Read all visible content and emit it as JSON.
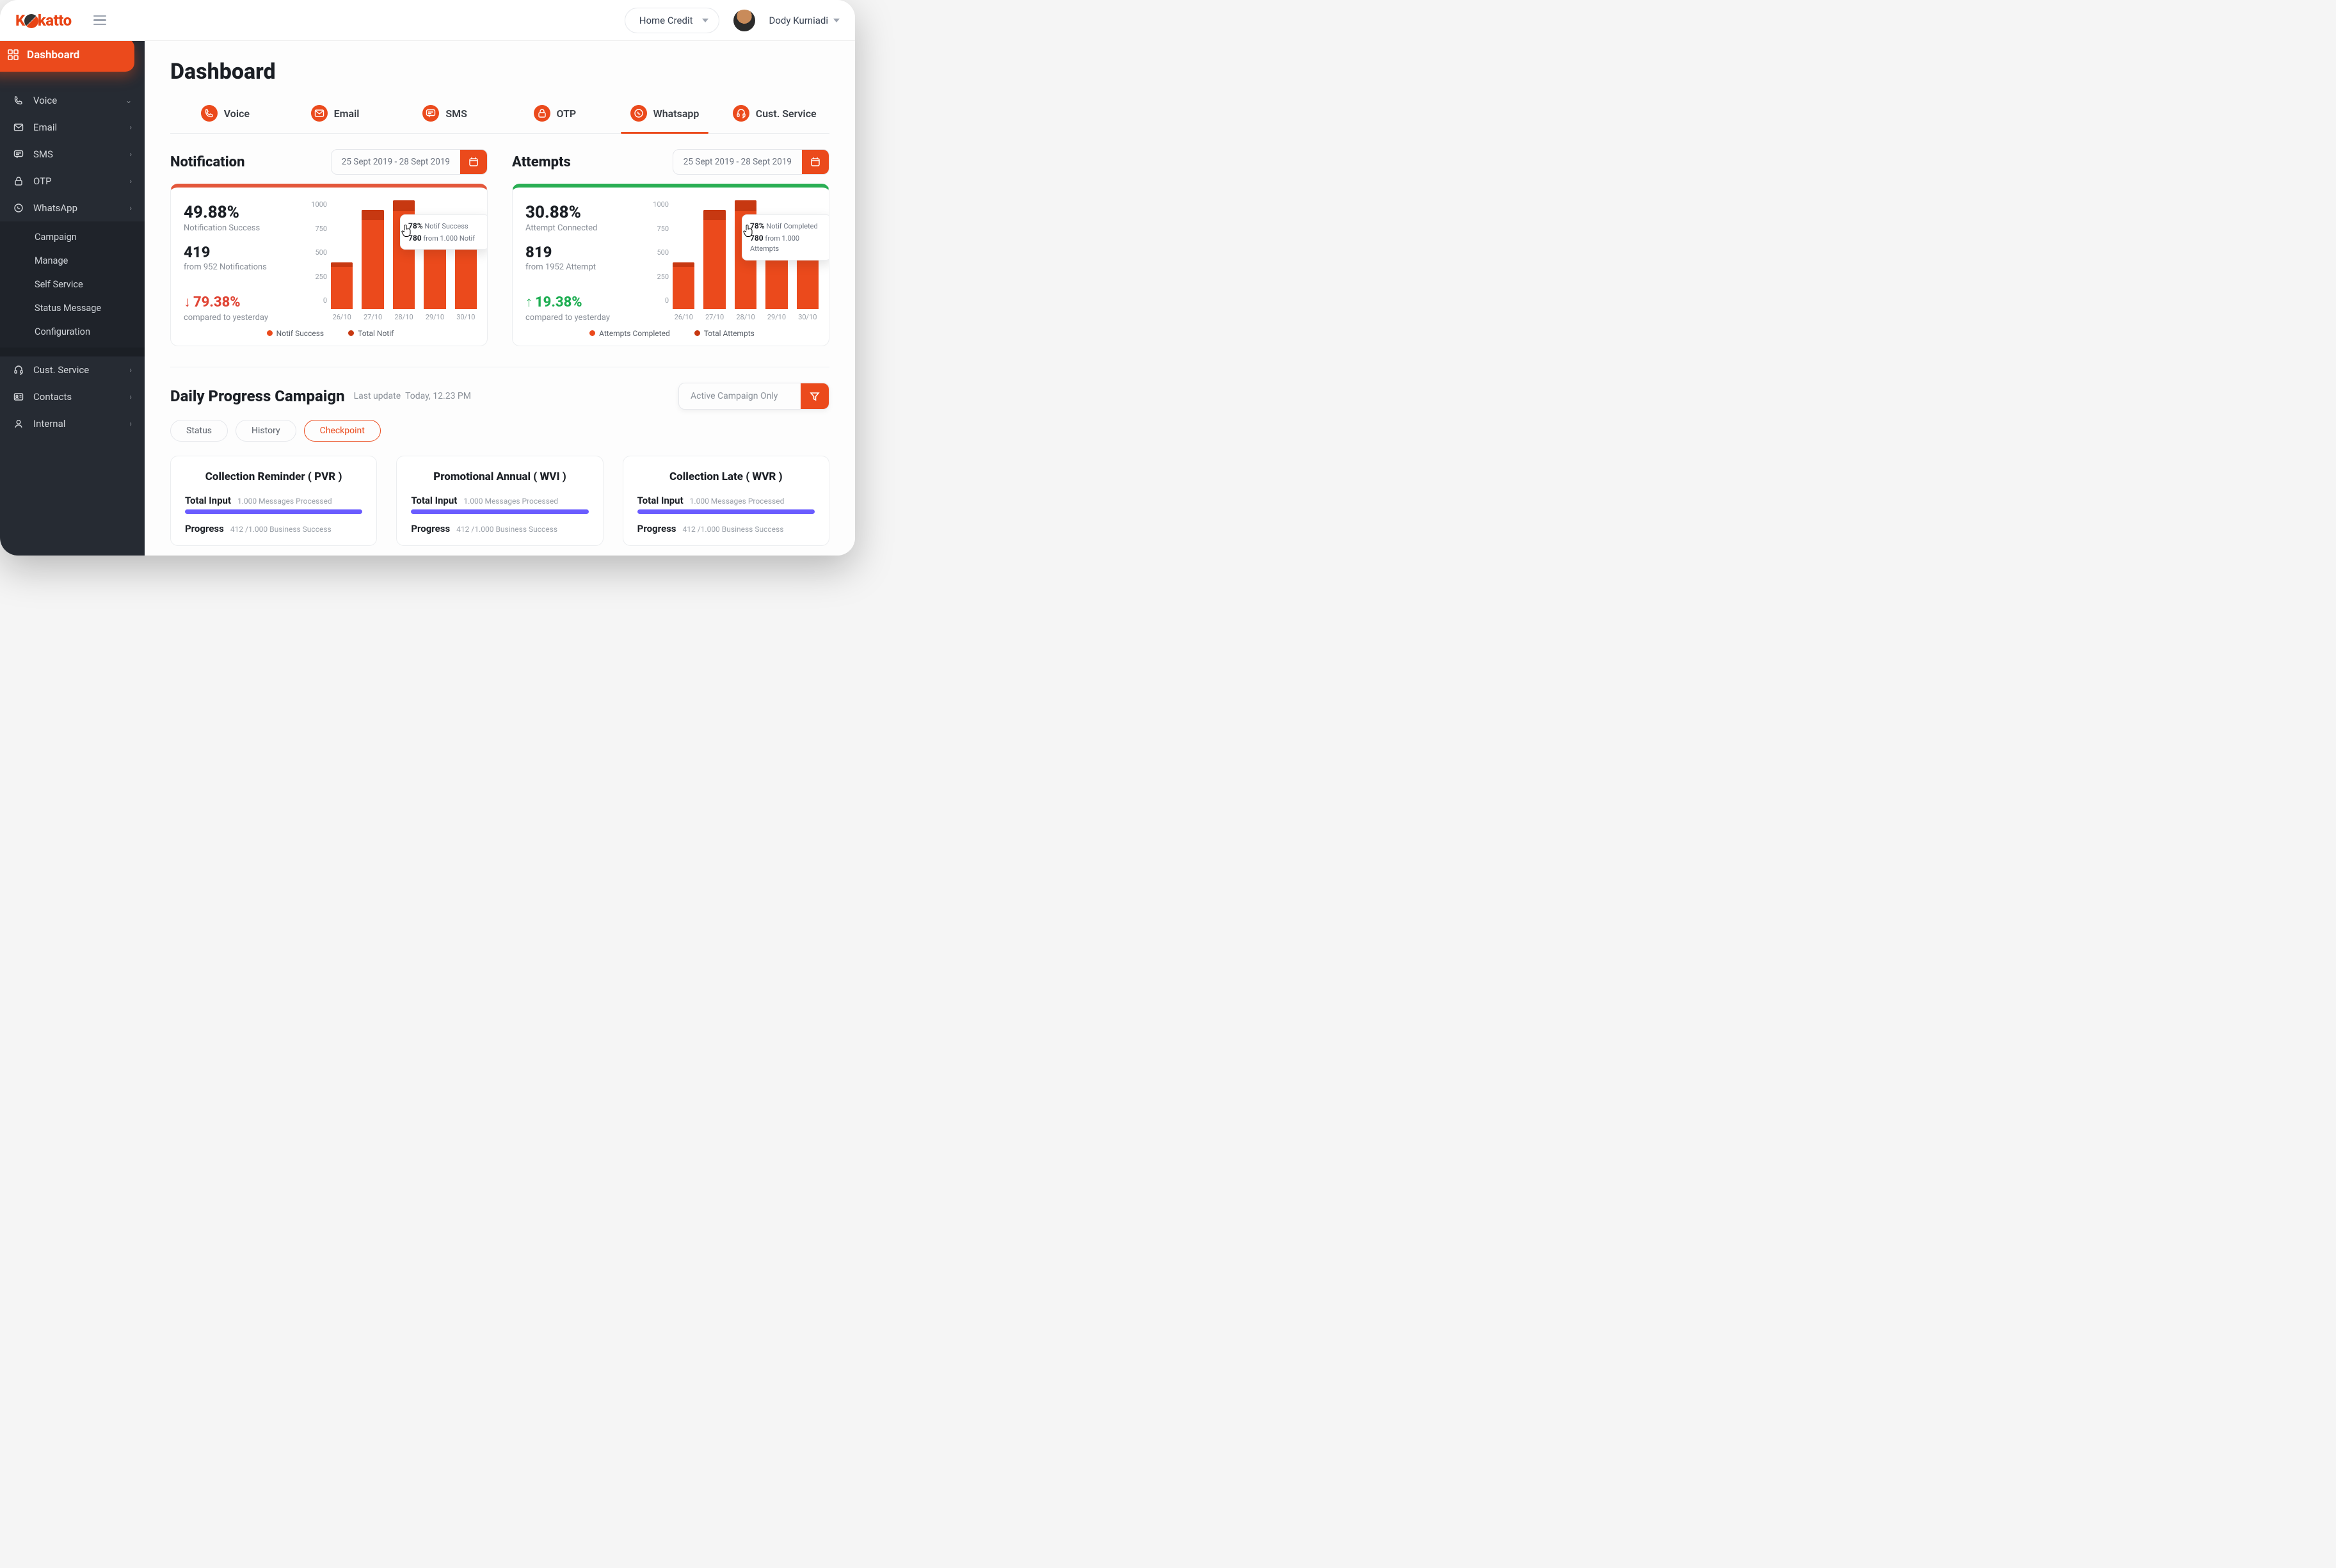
{
  "brand": "Kokatto",
  "header": {
    "credit_selector": "Home Credit",
    "user_name": "Dody Kurniadi"
  },
  "sidebar": {
    "active": "Dashboard",
    "items": [
      {
        "label": "Voice",
        "icon": "phone"
      },
      {
        "label": "Email",
        "icon": "mail"
      },
      {
        "label": "SMS",
        "icon": "chat"
      },
      {
        "label": "OTP",
        "icon": "lock"
      },
      {
        "label": "WhatsApp",
        "icon": "whatsapp"
      }
    ],
    "whatsapp_sub": [
      "Campaign",
      "Manage",
      "Self Service",
      "Status Message",
      "Configuration"
    ],
    "items2": [
      {
        "label": "Cust. Service",
        "icon": "headset"
      },
      {
        "label": "Contacts",
        "icon": "card"
      },
      {
        "label": "Internal",
        "icon": "user"
      }
    ]
  },
  "page_title": "Dashboard",
  "tabs": [
    "Voice",
    "Email",
    "SMS",
    "OTP",
    "Whatsapp",
    "Cust. Service"
  ],
  "active_tab": "Whatsapp",
  "notification": {
    "title": "Notification",
    "date_range": "25 Sept 2019 - 28 Sept 2019",
    "pct": "49.88%",
    "pct_label": "Notification Success",
    "count": "419",
    "count_label": "from 952 Notifications",
    "delta": "79.38%",
    "delta_dir": "down",
    "delta_label": "compared to yesterday",
    "legend": [
      "Notif Success",
      "Total Notif"
    ],
    "tooltip": {
      "pct": "78%",
      "pct_label": "Notif Success",
      "n": "780",
      "n_label": "from 1.000 Notif"
    }
  },
  "attempts": {
    "title": "Attempts",
    "date_range": "25 Sept 2019 - 28 Sept 2019",
    "pct": "30.88%",
    "pct_label": "Attempt Connected",
    "count": "819",
    "count_label": "from 1952 Attempt",
    "delta": "19.38%",
    "delta_dir": "up",
    "delta_label": "compared to yesterday",
    "legend": [
      "Attempts Completed",
      "Total Attempts"
    ],
    "tooltip": {
      "pct": "78%",
      "pct_label": "Notif Completed",
      "n": "780",
      "n_label": "from 1.000 Attempts"
    }
  },
  "chart_data": [
    {
      "type": "bar",
      "title": "Notification",
      "ylabel": "",
      "xlabel": "",
      "ylim": [
        0,
        1000
      ],
      "y_ticks": [
        1000,
        750,
        500,
        250,
        0
      ],
      "categories": [
        "26/10",
        "27/10",
        "28/10",
        "29/10",
        "30/10"
      ],
      "series": [
        {
          "name": "Notif Success",
          "values": [
            390,
            820,
            900,
            570,
            680
          ]
        },
        {
          "name": "Total Notif",
          "values": [
            430,
            910,
            1000,
            640,
            770
          ]
        }
      ]
    },
    {
      "type": "bar",
      "title": "Attempts",
      "ylabel": "",
      "xlabel": "",
      "ylim": [
        0,
        1000
      ],
      "y_ticks": [
        1000,
        750,
        500,
        250,
        0
      ],
      "categories": [
        "26/10",
        "27/10",
        "28/10",
        "29/10",
        "30/10"
      ],
      "series": [
        {
          "name": "Attempts Completed",
          "values": [
            390,
            820,
            900,
            570,
            680
          ]
        },
        {
          "name": "Total Attempts",
          "values": [
            430,
            910,
            1000,
            640,
            770
          ]
        }
      ]
    }
  ],
  "dpc": {
    "title": "Daily Progress Campaign",
    "updated_prefix": "Last update",
    "updated": "Today, 12.23 PM",
    "filter": "Active Campaign Only",
    "pills": [
      "Status",
      "History",
      "Checkpoint"
    ],
    "active_pill": "Checkpoint",
    "cards": [
      {
        "title": "Collection Reminder ( PVR )",
        "input_label": "Total Input",
        "input_sub": "1.000 Messages Processed",
        "input_pct": 100,
        "input_color": "#6a5cff",
        "progress_label": "Progress",
        "progress_sub": "412 /1.000 Business Success"
      },
      {
        "title": "Promotional Annual ( WVI )",
        "input_label": "Total Input",
        "input_sub": "1.000 Messages Processed",
        "input_pct": 100,
        "input_color": "#6a5cff",
        "progress_label": "Progress",
        "progress_sub": "412 /1.000 Business Success"
      },
      {
        "title": "Collection Late ( WVR )",
        "input_label": "Total Input",
        "input_sub": "1.000 Messages Processed",
        "input_pct": 100,
        "input_color": "#6a5cff",
        "progress_label": "Progress",
        "progress_sub": "412 /1.000 Business Success"
      }
    ]
  },
  "colors": {
    "brand": "#EB4A1C",
    "bar_cap": "#c73811",
    "green": "#1fae53"
  }
}
